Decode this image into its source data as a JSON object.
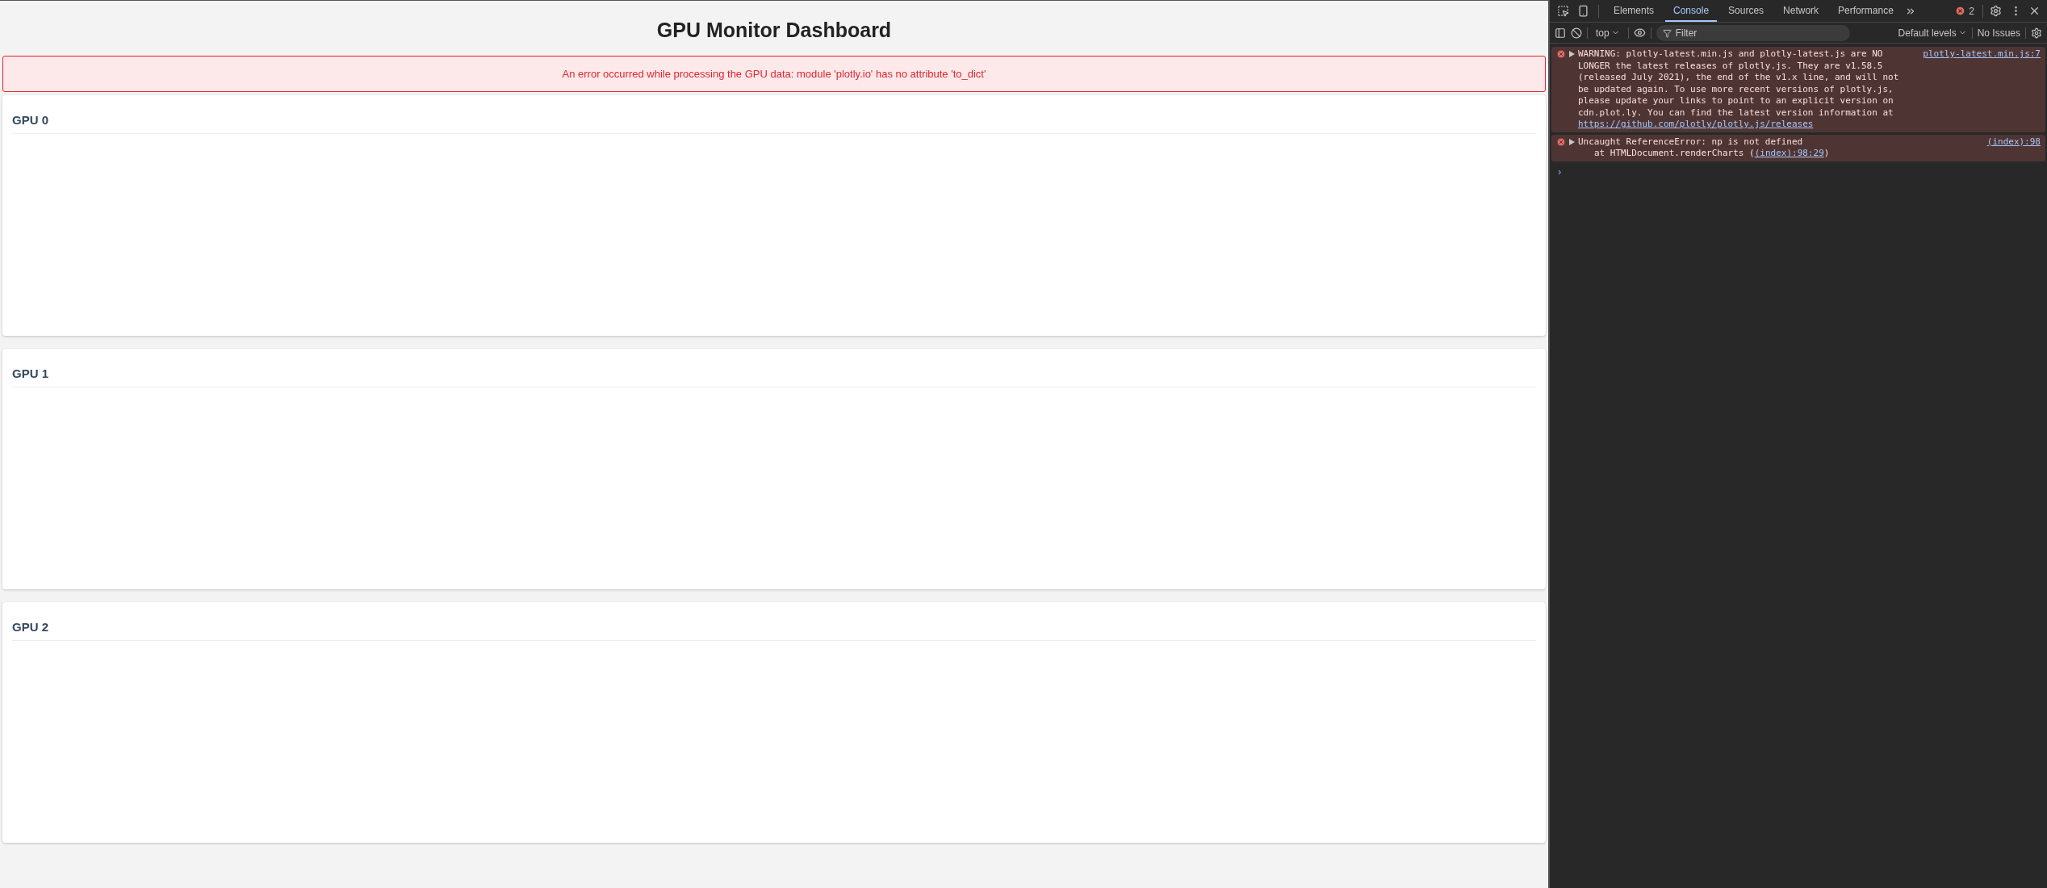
{
  "page": {
    "title": "GPU Monitor Dashboard",
    "error": "An error occurred while processing the GPU data: module 'plotly.io' has no attribute 'to_dict'",
    "gpus": [
      {
        "title": "GPU 0"
      },
      {
        "title": "GPU 1"
      },
      {
        "title": "GPU 2"
      }
    ]
  },
  "devtools": {
    "tabs": [
      {
        "label": "Elements",
        "selected": false
      },
      {
        "label": "Console",
        "selected": true
      },
      {
        "label": "Sources",
        "selected": false
      },
      {
        "label": "Network",
        "selected": false
      },
      {
        "label": "Performance",
        "selected": false
      }
    ],
    "error_count": "2",
    "context": "top",
    "filter": {
      "placeholder": "Filter"
    },
    "levels": "Default levels",
    "issues": "No Issues",
    "messages": [
      {
        "text": "WARNING: plotly-latest.min.js and plotly-latest.js are NO LONGER the latest releases of plotly.js. They are v1.58.5 (released July 2021), the end of the v1.x line, and will not be updated again. To use more recent versions of plotly.js, please update your links to point to an explicit version on cdn.plot.ly. You can find the latest version information at",
        "link": "https://github.com/plotly/plotly.js/releases",
        "source": "plotly-latest.min.js:7"
      },
      {
        "text": "Uncaught ReferenceError: np is not defined",
        "stack": "at HTMLDocument.renderCharts (",
        "stack_link": "(index):98:29",
        "stack_end": ")",
        "source": "(index):98"
      }
    ],
    "prompt": "›"
  }
}
